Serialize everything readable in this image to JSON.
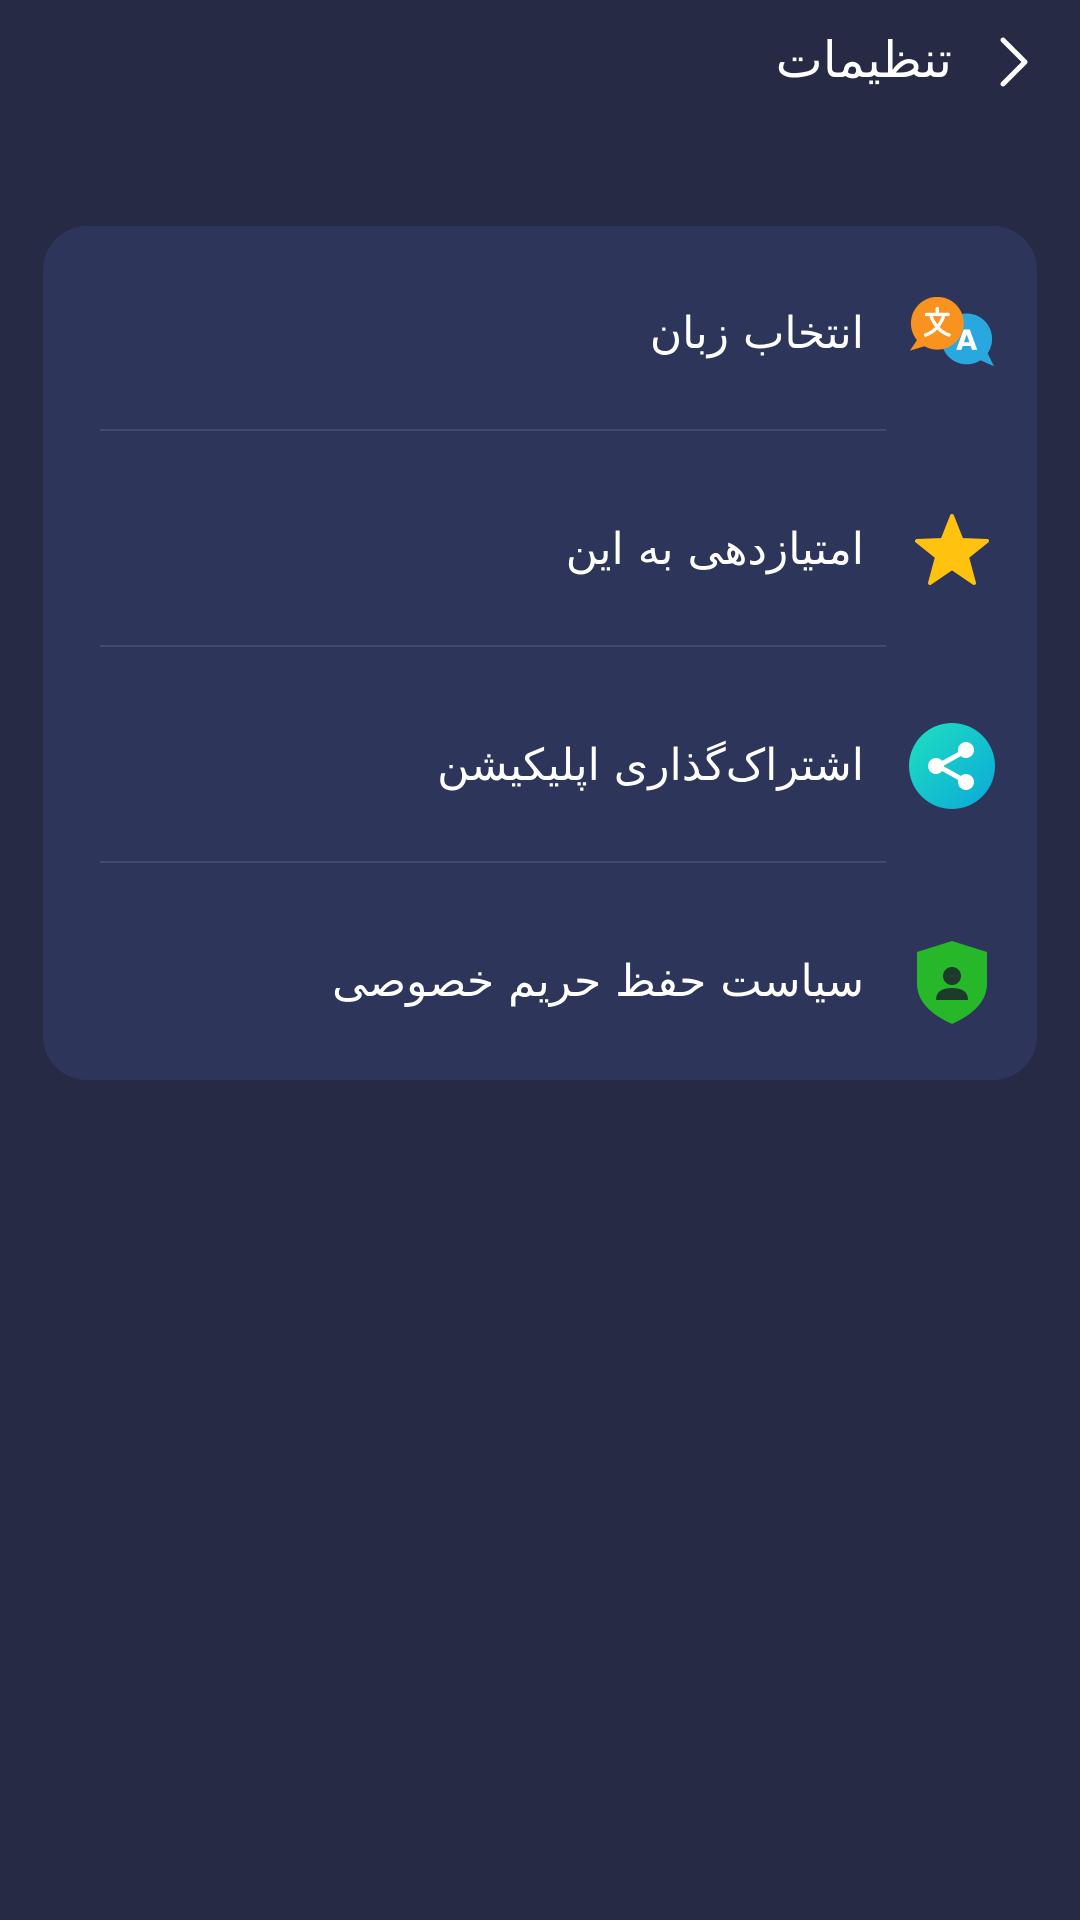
{
  "header": {
    "title": "تنظیمات",
    "back_icon": "chevron-right-icon"
  },
  "settings": {
    "items": [
      {
        "label": "انتخاب زبان",
        "icon": "translate-icon"
      },
      {
        "label": "امتیازدهی به این",
        "icon": "star-icon"
      },
      {
        "label": "اشتراک‌گذاری اپلیکیشن",
        "icon": "share-icon"
      },
      {
        "label": "سیاست حفظ حریم خصوصی",
        "icon": "privacy-shield-icon"
      }
    ]
  },
  "colors": {
    "background": "#262a44",
    "card": "#2d365a",
    "divider": "#414a70",
    "translate_orange": "#f7931e",
    "translate_blue": "#29a8e0",
    "star": "#ffc20e",
    "share_start": "#1fe0c0",
    "share_end": "#0aa8d8",
    "shield": "#27b82a"
  }
}
